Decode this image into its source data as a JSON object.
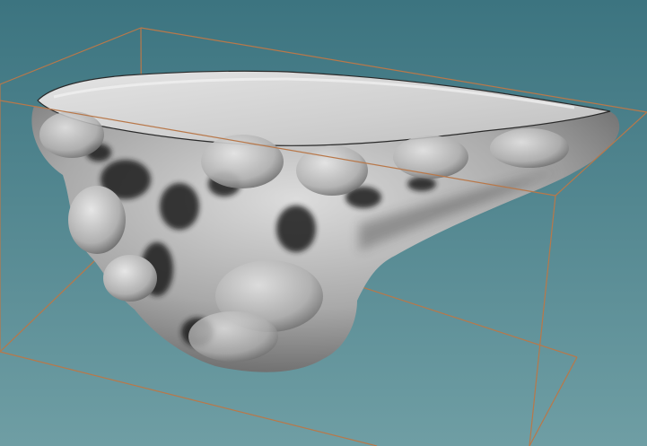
{
  "viewport": {
    "background_top": "#3c7480",
    "background_bottom": "#6f9ea4",
    "bounding_box_color": "#b8784a",
    "model_base_color": "#a9a9a9",
    "model_highlight_color": "#dcdcdc",
    "model_shadow_color": "#202020"
  }
}
